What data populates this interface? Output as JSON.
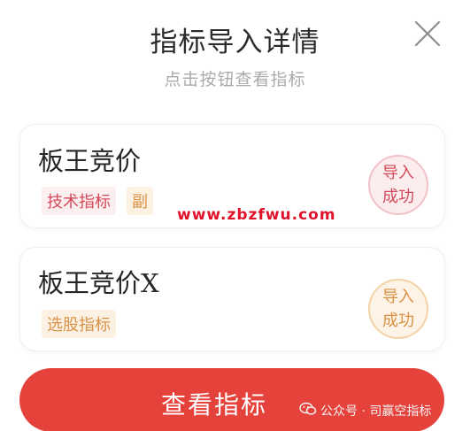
{
  "dialog": {
    "title": "指标导入详情",
    "subtitle": "点击按钮查看指标"
  },
  "indicators": [
    {
      "name": "板王竞价",
      "tags": [
        "技术指标",
        "副"
      ],
      "status": [
        "导入",
        "成功"
      ]
    },
    {
      "name": "板王竞价X",
      "tags": [
        "选股指标"
      ],
      "status": [
        "导入",
        "成功"
      ]
    }
  ],
  "watermark": "www.zbzfwu.com",
  "primary_button": "查看指标",
  "source_mark": "公众号 · 司赢空指标",
  "colors": {
    "accent": "#e4423b",
    "success_red": "#d34b5c",
    "success_orange": "#d99043",
    "watermark": "#e0112b"
  },
  "icons": {
    "close": "close-icon",
    "wechat": "wechat-icon"
  }
}
